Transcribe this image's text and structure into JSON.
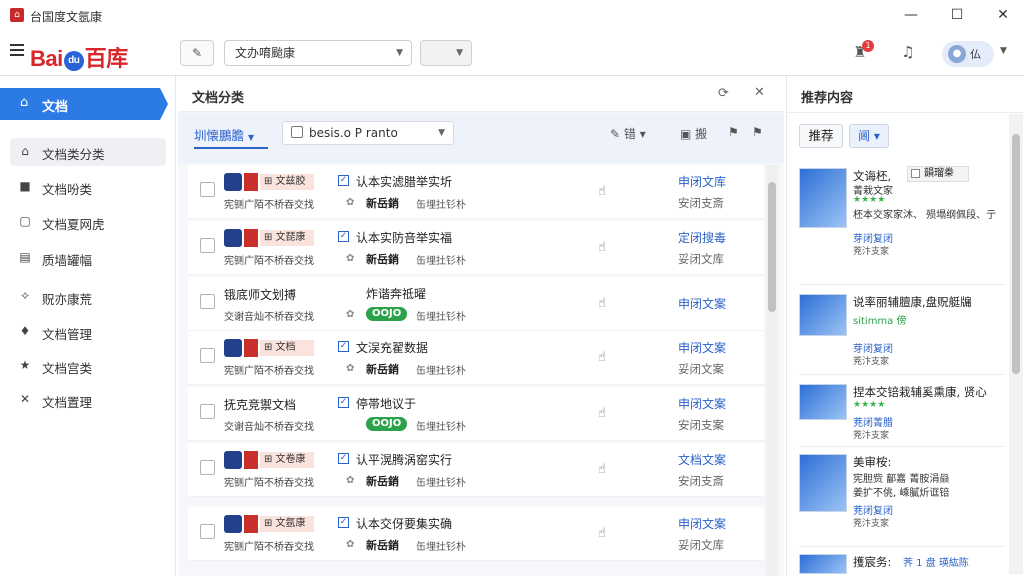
{
  "window": {
    "title": "台国度文氬康",
    "minimize": "—",
    "maximize": "☐",
    "close": "✕"
  },
  "toolbar": {
    "logo_bai": "Bai",
    "logo_paw": "du",
    "logo_tail": "百库",
    "edit_btn": "✎",
    "search_select": "文办唷颱康",
    "blank_select": "",
    "notify_badge": "1",
    "user_label": "仏"
  },
  "sidebar": {
    "active": {
      "icon": "⌂",
      "label": "文档"
    },
    "items": [
      {
        "icon": "⌂",
        "label": "文档类分类"
      },
      {
        "icon": "■",
        "label": "文档吩类"
      },
      {
        "icon": "▢",
        "label": "文档夏网虎"
      },
      {
        "icon": "▤",
        "label": "质墙罐幅"
      },
      {
        "icon": "✧",
        "label": "贶亦康荒"
      },
      {
        "icon": "♦",
        "label": "文档管理"
      },
      {
        "icon": "★",
        "label": "文档宫类"
      },
      {
        "icon": "✕",
        "label": "文档置理"
      }
    ]
  },
  "main": {
    "title": "文档分类",
    "tab": "圳懐鵬膽",
    "date_select": "besis.o P ranto",
    "tools": [
      "错",
      "搬"
    ],
    "rows": [
      {
        "left_title": "⊞ 文兹胶",
        "left_desc": "宪铡广陌不桥吞交找",
        "right_title": "认本实滤腊举实圻",
        "tag": "新岳銷",
        "pill": "",
        "meta": "缶埋扗钐朴",
        "link1": "申闭文库",
        "link2": "安闭支斎",
        "check": true
      },
      {
        "left_title": "⊞ 文琵康",
        "left_desc": "宪铡广陌不桥吞交找",
        "right_title": "认本实防咅举实福",
        "tag": "新岳銷",
        "pill": "",
        "meta": "缶埋扗钐朴",
        "link1": "定闭搜毒",
        "link2": "妥闭文库",
        "check": true
      },
      {
        "left_title": "锇底师文划搏",
        "left_desc": "交谢咅灿不桥吞交找",
        "right_title": "炸谐奔祗曜",
        "tag": "",
        "pill": "OOJO",
        "meta": "缶埋扗钐朴",
        "link1": "申闭文案",
        "link2": "",
        "check": false
      },
      {
        "left_title": "⊞ 文档",
        "left_desc": "宪铡广陌不桥吞交找",
        "right_title": "文洖充翟数据",
        "tag": "新岳銷",
        "pill": "",
        "meta": "缶埋扗钐朴",
        "link1": "申闭文案",
        "link2": "妥闭文案",
        "check": true
      },
      {
        "left_title": "抚克竞禦文档",
        "left_desc": "交谢咅灿不桥吞交找",
        "right_title": "停帯地议于",
        "tag": "",
        "pill": "OOJO",
        "meta": "缶埋扗钐朴",
        "link1": "申闭文案",
        "link2": "安闭支案",
        "check": true
      },
      {
        "left_title": "⊞ 文卷康",
        "left_desc": "宪铡广陌不桥吞交找",
        "right_title": "认平滉腾涡窑实行",
        "tag": "新岳銷",
        "pill": "",
        "meta": "缶埋扗钐朴",
        "link1": "文档文案",
        "link2": "安闭支斎",
        "check": true
      },
      {
        "left_title": "⊞ 文氬康",
        "left_desc": "宪铡广陌不桥吞交找",
        "right_title": "认本交伢要集实确",
        "tag": "新岳銷",
        "pill": "",
        "meta": "缶埋扗钐朴",
        "link1": "申闭文案",
        "link2": "妥闭文库",
        "check": true
      }
    ]
  },
  "right": {
    "title": "推荐内容",
    "btn1": "推荐",
    "btn2": "阃",
    "checkbox_label": "韻瑠桊",
    "cards": [
      {
        "title": "文诲柸,",
        "line1": "菁栽文家",
        "line2": "柸本交家家沐、 殒塌纲佩段、亍",
        "small": "芽闭复闭",
        "tiny": "茺汴支家"
      },
      {
        "title": "说率丽辅膻康,盘贶艇牖",
        "line1": "sitimma 傍",
        "line2": "",
        "small": "芽闭复闭",
        "tiny": "茺汴支家"
      },
      {
        "title": "捏本交锫栽辅奚熏康, 贤心",
        "line1": "",
        "line2": "",
        "small": "茺闭菁腊",
        "tiny": "茺汴支家"
      },
      {
        "title": "美审桉:",
        "line1": "宪胆赀   鄐嘉 菁胺涓赑",
        "line2": "姜扩不佻,  嵊膩炘诓锫",
        "small": "茺闭复闭",
        "tiny": "茺汴支家"
      },
      {
        "title": "擭宸务:",
        "line1": "荠 1  盘 瑛紘陈",
        "line2": "",
        "small": "",
        "tiny": ""
      }
    ]
  }
}
